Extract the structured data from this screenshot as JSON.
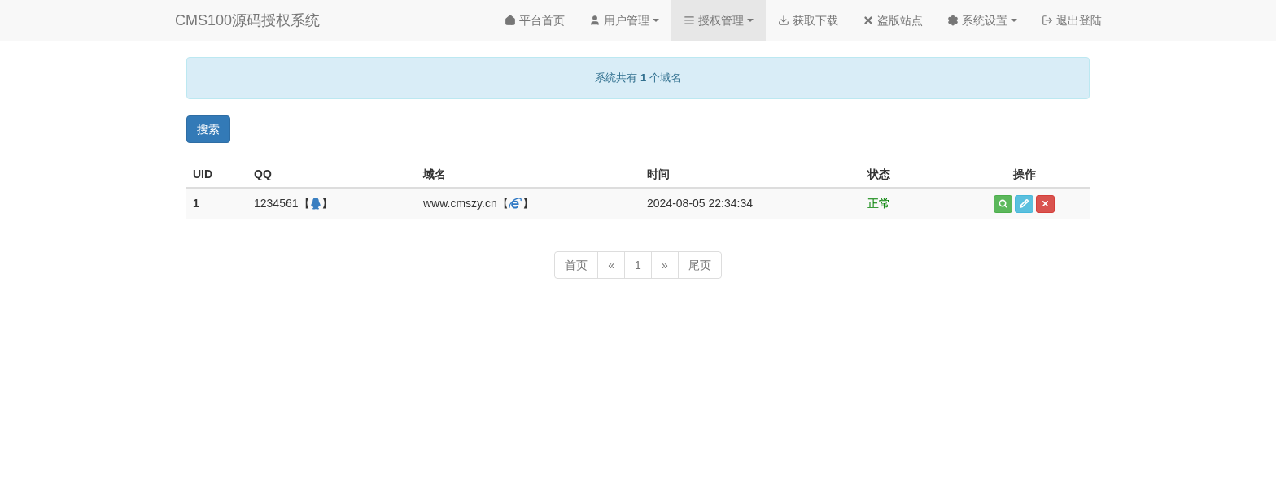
{
  "navbar": {
    "brand": "CMS100源码授权系统",
    "items": [
      {
        "label": "平台首页",
        "dropdown": false,
        "selected": false
      },
      {
        "label": "用户管理",
        "dropdown": true,
        "selected": false
      },
      {
        "label": "授权管理",
        "dropdown": true,
        "selected": true
      },
      {
        "label": "获取下载",
        "dropdown": false,
        "selected": false
      },
      {
        "label": "盗版站点",
        "dropdown": false,
        "selected": false
      },
      {
        "label": "系统设置",
        "dropdown": true,
        "selected": false
      },
      {
        "label": "退出登陆",
        "dropdown": false,
        "selected": false
      }
    ]
  },
  "alert": "系统共有 **1** 个域名",
  "search_button": "搜索",
  "table": {
    "columns": [
      "UID",
      "QQ",
      "域名",
      "时间",
      "状态",
      "操作"
    ],
    "rows": [
      {
        "uid": "1",
        "qq": "1234561",
        "qq_open": "【",
        "qq_close": "】",
        "domain": "www.cmszy.cn",
        "domain_open": "【",
        "domain_close": "】",
        "time": "2024-08-05 22:34:34",
        "status": "正常"
      }
    ]
  },
  "pagination": [
    "首页",
    "«",
    "1",
    "»",
    "尾页"
  ]
}
